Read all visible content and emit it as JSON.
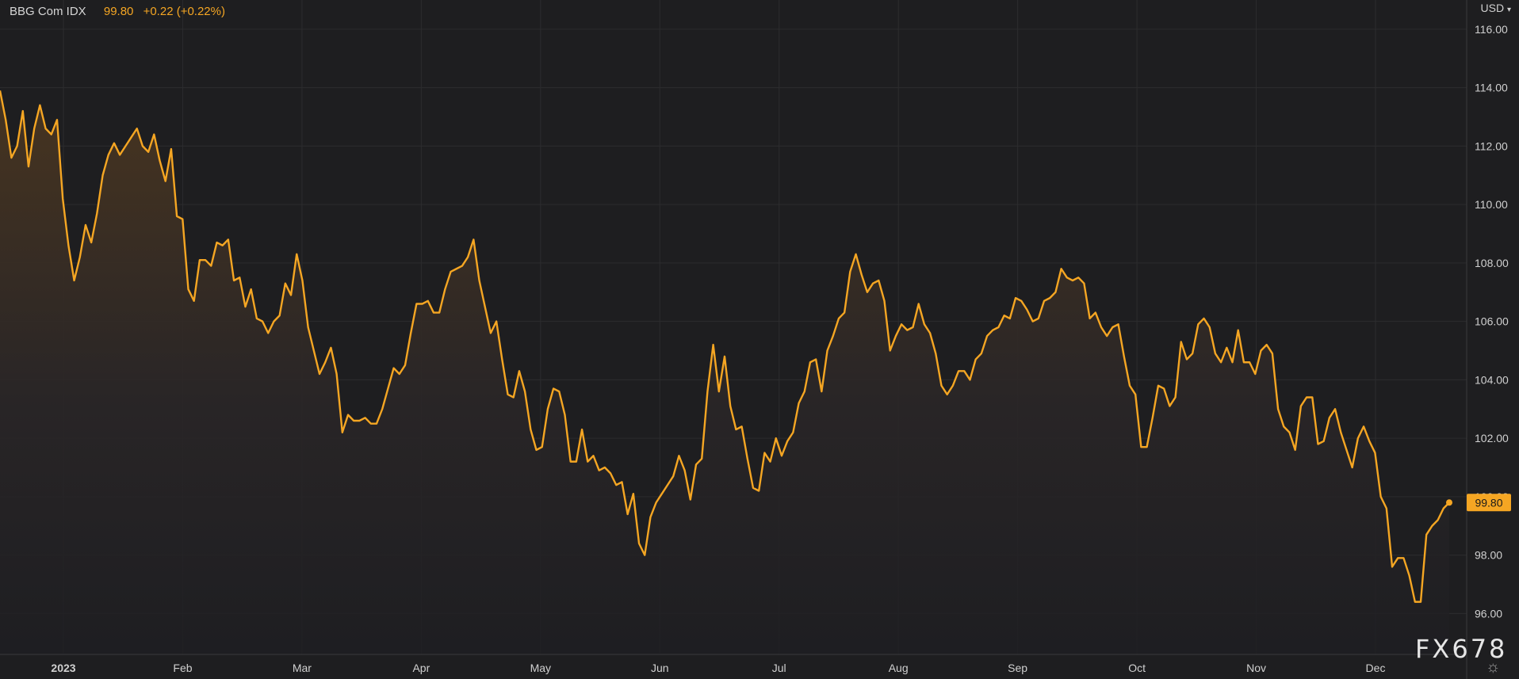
{
  "header": {
    "symbol": "BBG Com IDX",
    "price": "99.80",
    "change": "+0.22 (+0.22%)"
  },
  "currency": "USD",
  "currency_chevron_icon": "chevron-down-icon",
  "watermark": "FX678",
  "settings_icon": "sun-gear-icon",
  "colors": {
    "background": "#1e1e20",
    "line": "#f5a623",
    "grid": "#2c2c2e",
    "axis_text": "#d0d0d0",
    "price_tag_bg": "#f5a623"
  },
  "chart_data": {
    "type": "area",
    "series": [
      {
        "values": [
          113.9,
          112.9,
          111.6,
          112.0,
          113.2,
          111.3,
          112.6,
          113.4,
          112.6,
          112.4,
          112.9,
          110.2,
          108.6,
          107.4,
          108.2,
          109.3,
          108.7,
          109.7,
          111.0,
          111.7,
          112.1,
          111.7,
          112.0,
          112.3,
          112.6,
          112.0,
          111.8,
          112.4,
          111.5,
          110.8,
          111.9,
          109.6,
          109.5,
          107.1,
          106.7,
          108.1,
          108.1,
          107.9,
          108.7,
          108.6,
          108.8,
          107.4,
          107.5,
          106.5,
          107.1,
          106.1,
          106.0,
          105.6,
          106.0,
          106.2,
          107.3,
          106.9,
          108.3,
          107.4,
          105.8,
          105.0,
          104.2,
          104.6,
          105.1,
          104.2,
          102.2,
          102.8,
          102.6,
          102.6,
          102.7,
          102.5,
          102.5,
          103.0,
          103.7,
          104.4,
          104.2,
          104.5,
          105.6,
          106.6,
          106.6,
          106.7,
          106.3,
          106.3,
          107.1,
          107.7,
          107.8,
          107.9,
          108.2,
          108.8,
          107.4,
          106.5,
          105.6,
          106.0,
          104.7,
          103.5,
          103.4,
          104.3,
          103.6,
          102.3,
          101.6,
          101.7,
          103.0,
          103.7,
          103.6,
          102.8,
          101.2,
          101.2,
          102.3,
          101.2,
          101.4,
          100.9,
          101.0,
          100.8,
          100.4,
          100.5,
          99.4,
          100.1,
          98.4,
          98.0,
          99.3,
          99.8,
          100.1,
          100.4,
          100.7,
          101.4,
          100.9,
          99.9,
          101.1,
          101.3,
          103.6,
          105.2,
          103.6,
          104.8,
          103.1,
          102.3,
          102.4,
          101.3,
          100.3,
          100.2,
          101.5,
          101.2,
          102.0,
          101.4,
          101.9,
          102.2,
          103.2,
          103.6,
          104.6,
          104.7,
          103.6,
          105.0,
          105.5,
          106.1,
          106.3,
          107.7,
          108.3,
          107.6,
          107.0,
          107.3,
          107.4,
          106.7,
          105.0,
          105.5,
          105.9,
          105.7,
          105.8,
          106.6,
          105.9,
          105.6,
          104.9,
          103.8,
          103.5,
          103.8,
          104.3,
          104.3,
          104.0,
          104.7,
          104.9,
          105.5,
          105.7,
          105.8,
          106.2,
          106.1,
          106.8,
          106.7,
          106.4,
          106.0,
          106.1,
          106.7,
          106.8,
          107.0,
          107.8,
          107.5,
          107.4,
          107.5,
          107.3,
          106.1,
          106.3,
          105.8,
          105.5,
          105.8,
          105.9,
          104.8,
          103.8,
          103.5,
          101.7,
          101.7,
          102.7,
          103.8,
          103.7,
          103.1,
          103.4,
          105.3,
          104.7,
          104.9,
          105.9,
          106.1,
          105.8,
          104.9,
          104.6,
          105.1,
          104.6,
          105.7,
          104.6,
          104.6,
          104.2,
          105.0,
          105.2,
          104.9,
          103.0,
          102.4,
          102.2,
          101.6,
          103.1,
          103.4,
          103.4,
          101.8,
          101.9,
          102.7,
          103.0,
          102.2,
          101.6,
          101.0,
          102.0,
          102.4,
          101.9,
          101.5,
          100.0,
          99.6,
          97.6,
          97.9,
          97.9,
          97.3,
          96.4,
          96.4,
          98.7,
          99.0,
          99.2,
          99.6,
          99.8
        ]
      }
    ],
    "x_labels": [
      "2023",
      "Feb",
      "Mar",
      "Apr",
      "May",
      "Jun",
      "Jul",
      "Aug",
      "Sep",
      "Oct",
      "Nov",
      "Dec"
    ],
    "y_ticks": [
      "116.00",
      "114.00",
      "112.00",
      "110.00",
      "108.00",
      "106.00",
      "104.00",
      "102.00",
      "100.00",
      "98.00",
      "96.00"
    ],
    "ylim": [
      94.6,
      117.0
    ],
    "last_value_label": "99.80",
    "grid": true
  }
}
